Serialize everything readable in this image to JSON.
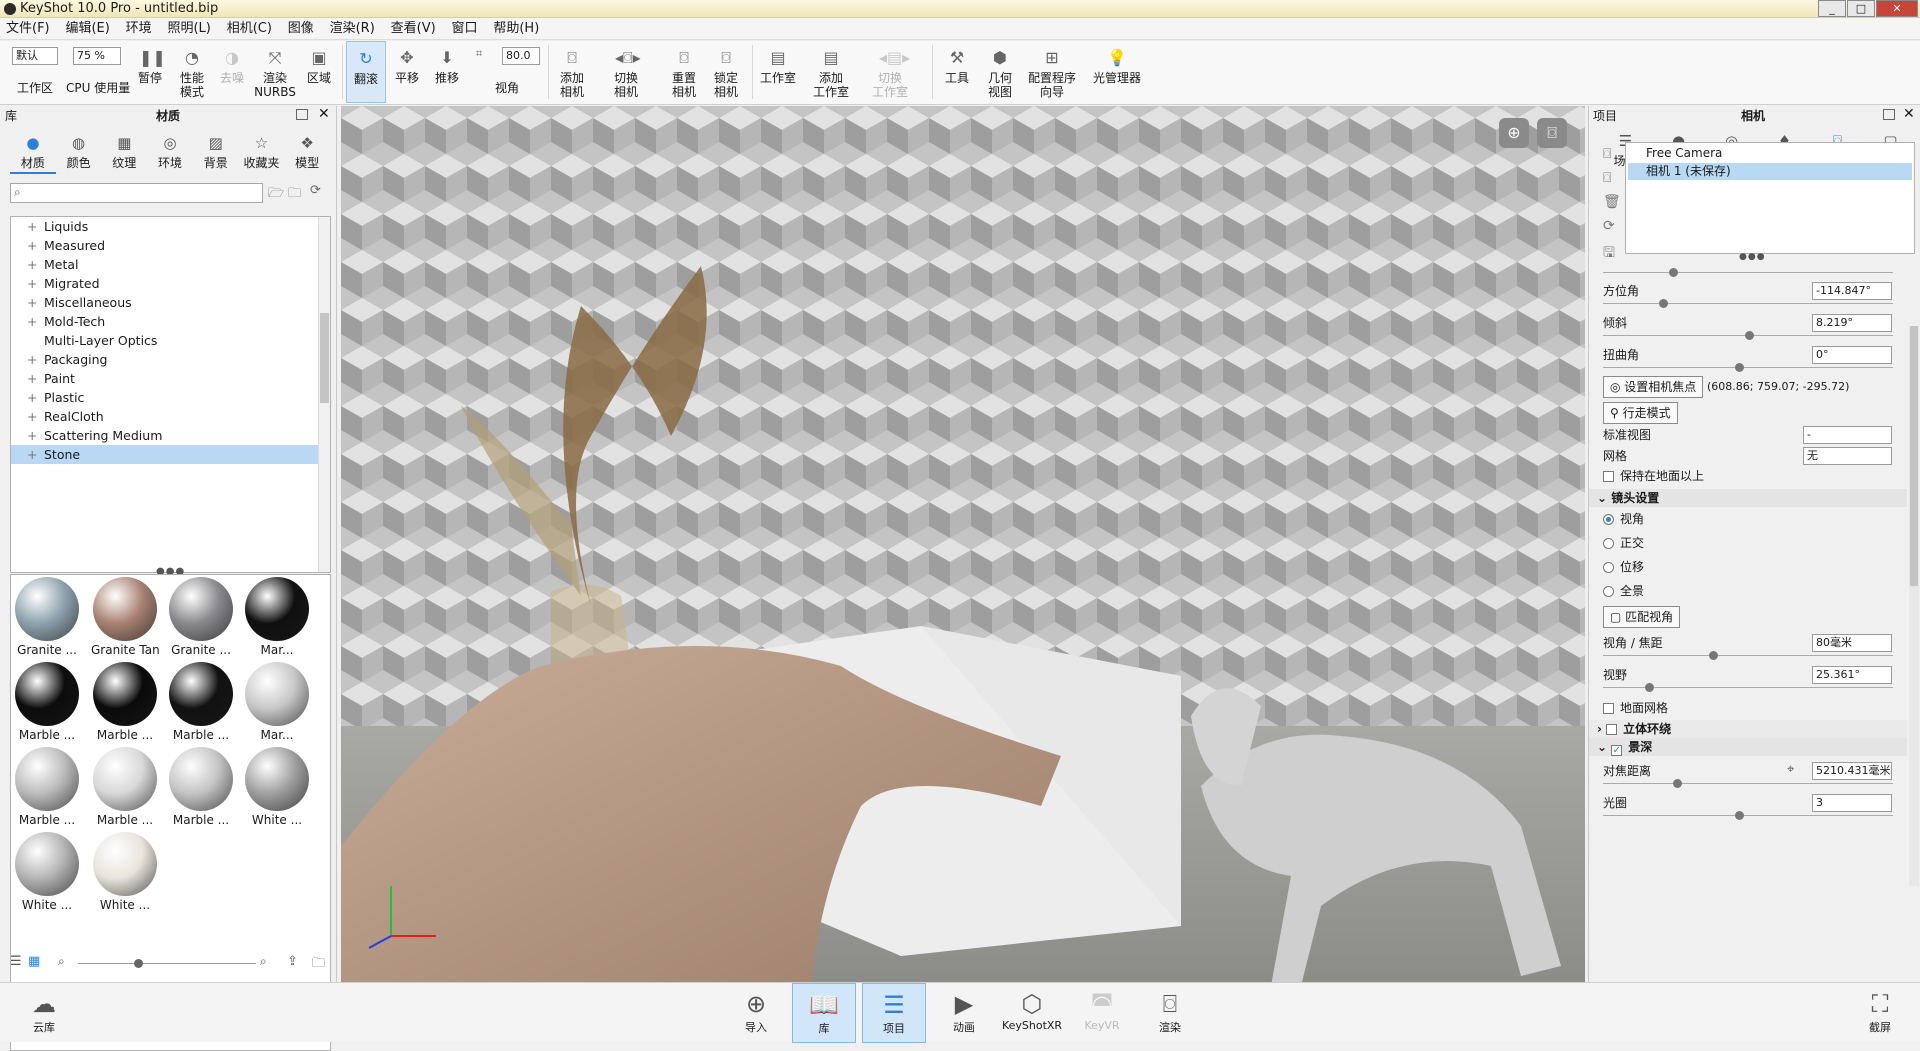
{
  "window": {
    "title": "KeyShot 10.0 Pro  - untitled.bip",
    "min": "_",
    "max": "□",
    "close": "✕"
  },
  "menu": [
    "文件(F)",
    "编辑(E)",
    "环境",
    "照明(L)",
    "相机(C)",
    "图像",
    "渲染(R)",
    "查看(V)",
    "窗口",
    "帮助(H)"
  ],
  "ribbon": {
    "workspace_value": "默认",
    "workspace_label": "工作区",
    "cpu_value": "75 %",
    "cpu_label": "CPU 使用量",
    "pause": "暂停",
    "perf": "性能\n模式",
    "denoise": "去噪",
    "nurbs": "渲染\nNURBS",
    "region": "区域",
    "tumble": "翻滚",
    "pan": "平移",
    "dolly": "推移",
    "fov_value": "80.0",
    "fov_label": "视角",
    "add_camera": "添加\n相机",
    "switch_camera": "切换\n相机",
    "reset_camera": "重置\n相机",
    "lock_camera": "锁定\n相机",
    "studio": "工作室",
    "add_studio": "添加\n工作室",
    "switch_studio": "切换\n工作室",
    "tools": "工具",
    "geometry_view": "几何\n视图",
    "config_wizard": "配置程序\n向导",
    "light_manager": "光管理器"
  },
  "library": {
    "title": "库",
    "tab_title": "材质",
    "tabs": [
      "材质",
      "颜色",
      "纹理",
      "环境",
      "背景",
      "收藏夹",
      "模型"
    ],
    "tree": [
      {
        "label": "Liquids",
        "plus": "+"
      },
      {
        "label": "Measured",
        "plus": "+"
      },
      {
        "label": "Metal",
        "plus": "+"
      },
      {
        "label": "Migrated",
        "plus": "+"
      },
      {
        "label": "Miscellaneous",
        "plus": "+"
      },
      {
        "label": "Mold-Tech",
        "plus": "+"
      },
      {
        "label": "Multi-Layer Optics",
        "plus": ""
      },
      {
        "label": "Packaging",
        "plus": "+"
      },
      {
        "label": "Paint",
        "plus": "+"
      },
      {
        "label": "Plastic",
        "plus": "+"
      },
      {
        "label": "RealCloth",
        "plus": "+"
      },
      {
        "label": "Scattering Medium",
        "plus": "+"
      },
      {
        "label": "Stone",
        "plus": "+"
      }
    ],
    "materials": [
      {
        "name": "Granite ...",
        "color": "#8ea2ae"
      },
      {
        "name": "Granite Tan",
        "color": "#a88272"
      },
      {
        "name": "Granite ...",
        "color": "#8a8a8e"
      },
      {
        "name": "Mar...",
        "color": "#101010"
      },
      {
        "name": "Marble ...",
        "color": "#0c0c0c"
      },
      {
        "name": "Marble ...",
        "color": "#0a0a0a"
      },
      {
        "name": "Marble ...",
        "color": "#111111"
      },
      {
        "name": "Mar...",
        "color": "#c8c8c8"
      },
      {
        "name": "Marble ...",
        "color": "#bcbcbc"
      },
      {
        "name": "Marble ...",
        "color": "#d8d8d8"
      },
      {
        "name": "Marble ...",
        "color": "#c4c4c4"
      },
      {
        "name": "White ...",
        "color": "#a0a0a0"
      },
      {
        "name": "White ...",
        "color": "#b4b4b4"
      },
      {
        "name": "White ...",
        "color": "#e8e4dc"
      }
    ]
  },
  "project": {
    "title": "项目",
    "tab_title": "相机",
    "tabs": [
      "场景",
      "材质",
      "环境",
      "照明",
      "相机",
      "图像"
    ],
    "cameras": [
      "Free Camera",
      "相机 1 (未保存)"
    ],
    "azimuth_label": "方位角",
    "azimuth": "-114.847°",
    "incl_label": "倾斜",
    "incl": "8.219°",
    "twist_label": "扭曲角",
    "twist": "0°",
    "set_focus": "设置相机焦点",
    "focus_coords": "(608.86; 759.07; -295.72)",
    "walk_mode": "行走模式",
    "std_view_label": "标准视图",
    "std_view": "-",
    "grid_label": "网格",
    "grid": "无",
    "keep_above": "保持在地面以上",
    "lens_title": "镜头设置",
    "lens_opts": [
      "视角",
      "正交",
      "位移",
      "全景"
    ],
    "match_persp": "匹配视角",
    "fov_label": "视角 / 焦距",
    "fov_value": "80毫米",
    "field_label": "视野",
    "field_value": "25.361°",
    "ground_grid": "地面网格",
    "stereo": "立体环绕",
    "dof": "景深",
    "focus_dist_label": "对焦距离",
    "focus_dist": "5210.431毫米",
    "aperture_label": "光圈",
    "aperture": "3"
  },
  "bottom": {
    "cloud": "云库",
    "import": "导入",
    "library": "库",
    "project": "项目",
    "animation": "动画",
    "keyshotxr": "KeyShotXR",
    "keyvr": "KeyVR",
    "render": "渲染",
    "screenshot": "截屏"
  }
}
